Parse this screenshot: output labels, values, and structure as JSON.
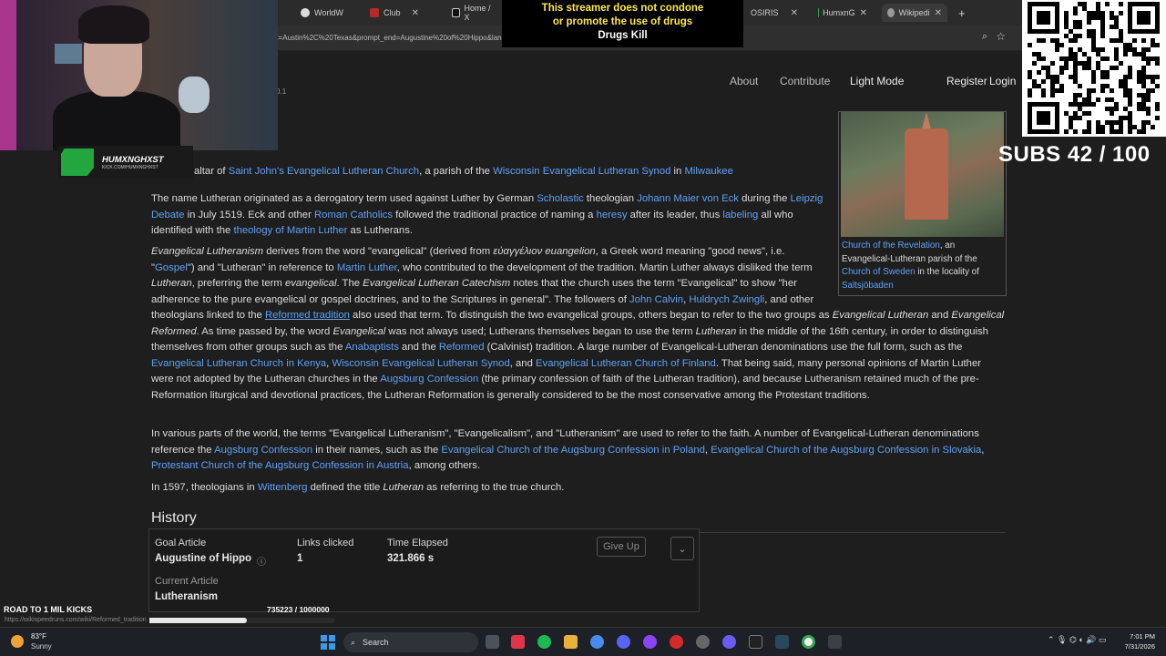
{
  "browser": {
    "tabs": [
      {
        "label": "WorldW",
        "active": false
      },
      {
        "label": "Club",
        "active": false
      },
      {
        "label": "Home / X",
        "active": false
      },
      {
        "label": "OSIRIS",
        "active": false
      },
      {
        "label": "HumxnG",
        "active": false
      },
      {
        "label": "Wikipedi",
        "active": true
      }
    ],
    "url": "tart=Austin%2C%20Texas&prompt_end=Augustine%20of%20Hippo&lang=en"
  },
  "site": {
    "version": "V. 0.1",
    "nav": {
      "about": "About",
      "contribute": "Contribute",
      "light_mode": "Light Mode",
      "register": "Register",
      "login": "Login"
    }
  },
  "article": {
    "p0": {
      "t1": "altar of ",
      "l1": "Saint John's Evangelical Lutheran Church",
      "t2": ", a parish of the ",
      "l2": "Wisconsin Evangelical Lutheran Synod",
      "t3": " in ",
      "l3": "Milwaukee"
    },
    "p1": {
      "t1": "The name Lutheran originated as a derogatory term used against Luther by German ",
      "l1": "Scholastic",
      "t2": " theologian ",
      "l2": "Johann Maier von Eck",
      "t3": " during the ",
      "l3": "Leipzig Debate",
      "t4": " in July 1519. Eck and other ",
      "l4": "Roman Catholics",
      "t5": " followed the traditional practice of naming a ",
      "l5": "heresy",
      "t6": " after its leader, thus ",
      "l6": "labeling",
      "t7": " all who identified with the ",
      "l7": "theology of Martin Luther",
      "t8": " as Lutherans."
    },
    "p2": {
      "i1": "Evangelical Lutheranism",
      "t1": " derives from the word \"evangelical\" (derived from ",
      "i2": "εὐαγγέλιον euangelion",
      "t2": ", a Greek word meaning \"good news\", i.e. \"",
      "l1": "Gospel",
      "t3": "\") and \"Lutheran\" in reference to ",
      "l2": "Martin Luther",
      "t4": ", who contributed to the development of the tradition. Martin Luther always disliked the term ",
      "i3": "Lutheran",
      "t5": ", preferring the term ",
      "i4": "evangelical",
      "t6": ". The ",
      "i5": "Evangelical Lutheran Catechism",
      "t7": " notes that the church uses the term \"Evangelical\" to show \"her adherence to the pure evangelical or gospel doctrines, and to the Scriptures in general\". The followers of ",
      "l3": "John Calvin",
      "t8": ", ",
      "l4": "Huldrych Zwingli",
      "t9": ", and other theologians linked to the ",
      "l5": "Reformed tradition",
      "t10": " also used that term. To distinguish the two evangelical groups, others began to refer to the two groups as ",
      "i6": "Evangelical Lutheran",
      "t11": " and ",
      "i7": "Evangelical Reformed",
      "t12": ". As time passed by, the word ",
      "i8": "Evangelical",
      "t13": " was not always used; Lutherans themselves began to use the term ",
      "i9": "Lutheran",
      "t14": " in the middle of the 16th century, in order to distinguish themselves from other groups such as the ",
      "l6": "Anabaptists",
      "t15": " and the ",
      "l7": "Reformed",
      "t16": " (Calvinist) tradition. A large number of Evangelical-Lutheran denominations use the full form, such as the ",
      "l8": "Evangelical Lutheran Church in Kenya",
      "t17": ", ",
      "l9": "Wisconsin Evangelical Lutheran Synod",
      "t18": ", and ",
      "l10": "Evangelical Lutheran Church of Finland",
      "t19": ". That being said, many personal opinions of Martin Luther were not adopted by the Lutheran churches in the ",
      "l11": "Augsburg Confession",
      "t20": " (the primary confession of faith of the Lutheran tradition), and because Lutheranism retained much of the pre-Reformation liturgical and devotional practices, the Lutheran Reformation is generally considered to be the most conservative among the Protestant traditions."
    },
    "p3": {
      "t1": "In various parts of the world, the terms \"Evangelical Lutheranism\", \"Evangelicalism\", and \"Lutheranism\" are used to refer to the faith. A number of Evangelical-Lutheran denominations reference the ",
      "l1": "Augsburg Confession",
      "t2": " in their names, such as the ",
      "l2": "Evangelical Church of the Augsburg Confession in Poland",
      "t3": ", ",
      "l3": "Evangelical Church of the Augsburg Confession in Slovakia",
      "t4": ", ",
      "l4": "Protestant Church of the Augsburg Confession in Austria",
      "t5": ", among others."
    },
    "p4": {
      "t1": "In 1597, theologians in ",
      "l1": "Wittenberg",
      "t2": " defined the title ",
      "i1": "Lutheran",
      "t3": " as referring to the true church."
    },
    "history_heading": "History"
  },
  "infobox": {
    "caption_link1": "Church of the Revelation",
    "caption_t1": ", an Evangelical-Lutheran parish of the ",
    "caption_link2": "Church of Sweden",
    "caption_t2": " in the locality of ",
    "caption_link3": "Saltsjöbaden"
  },
  "game": {
    "goal_label": "Goal Article",
    "goal_value": "Augustine of Hippo",
    "links_label": "Links clicked",
    "links_value": "1",
    "time_label": "Time Elapsed",
    "time_value": "321.866 s",
    "current_label": "Current Article",
    "current_value": "Lutheranism",
    "give_up": "Give Up",
    "toggle_icon": "chevron-down-icon"
  },
  "overlay": {
    "disclaimer_line1": "This streamer does not condone",
    "disclaimer_line2": "or promote the use of drugs",
    "disclaimer_line3": "Drugs Kill",
    "streamer_name": "HUMXNGHXST",
    "streamer_sub": "KICK.COM/HUMXNGHXST",
    "subs": "SUBS 42 / 100",
    "kicks_label": "ROAD TO 1 MIL KICKS",
    "kicks_value": "735223 / 1000000",
    "kicks_fraction": 0.735,
    "status_url": "https://wikispeedruns.com/wiki/Reformed_tradition"
  },
  "taskbar": {
    "weather_temp": "83°F",
    "weather_desc": "Sunny",
    "search": "Search",
    "time": "7:01 PM",
    "date": "7/31/2026"
  },
  "colors": {
    "link": "#5ea2f5",
    "background": "#1e1e1f",
    "qr": "#ffffff",
    "disclaimer_text": "#ffe94a"
  }
}
